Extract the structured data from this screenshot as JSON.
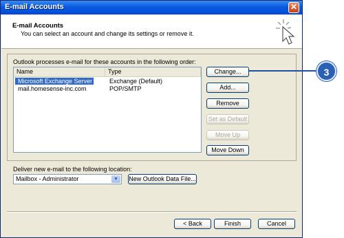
{
  "window": {
    "title": "E-mail Accounts",
    "close_glyph": "✕"
  },
  "header": {
    "title": "E-mail Accounts",
    "subtitle": "You can select an account and change its settings or remove it.",
    "icon": "wizard-cursor-icon"
  },
  "accounts": {
    "intro": "Outlook processes e-mail for these accounts in the following order:",
    "columns": [
      "Name",
      "Type"
    ],
    "rows": [
      {
        "name": "Microsoft Exchange Server",
        "type": "Exchange (Default)",
        "selected": true
      },
      {
        "name": "mail.homesense-inc.com",
        "type": "POP/SMTP",
        "selected": false
      }
    ]
  },
  "side_buttons": {
    "change": "Change...",
    "add": "Add...",
    "remove": "Remove",
    "set_default": "Set as Default",
    "move_up": "Move Up",
    "move_down": "Move Down"
  },
  "delivery": {
    "label": "Deliver new e-mail to the following location:",
    "selected": "Mailbox - Administrator",
    "new_file_button": "New Outlook Data File..."
  },
  "footer": {
    "back": "< Back",
    "finish": "Finish",
    "cancel": "Cancel"
  },
  "callout": {
    "number": "3"
  },
  "colors": {
    "titlebar": "#0a5ae0",
    "selection": "#316ac5",
    "callout": "#2b61b5",
    "dialog_bg": "#ece9d8"
  }
}
